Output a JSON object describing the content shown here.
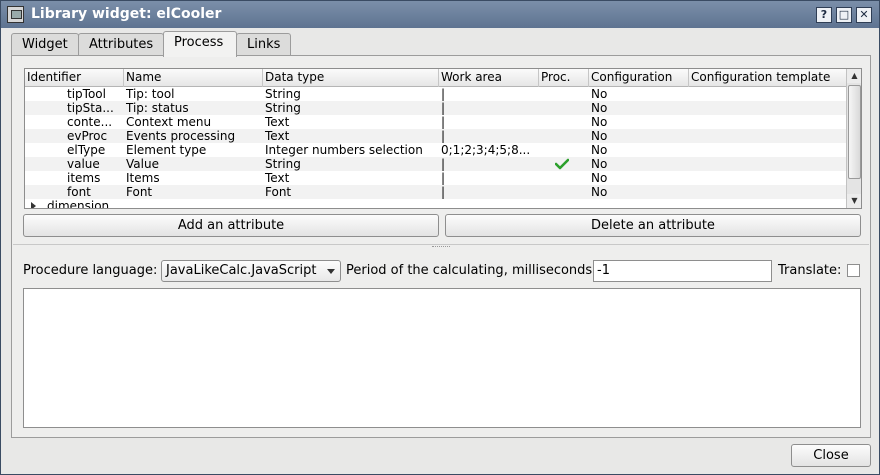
{
  "window": {
    "title": "Library widget: elCooler",
    "help_label": "?",
    "maximize_label": "□",
    "close_label": "✕"
  },
  "tabs": [
    {
      "label": "Widget"
    },
    {
      "label": "Attributes"
    },
    {
      "label": "Process"
    },
    {
      "label": "Links"
    }
  ],
  "table": {
    "columns": [
      "Identifier",
      "Name",
      "Data type",
      "Work area",
      "Proc.",
      "Configuration",
      "Configuration template"
    ],
    "rows": [
      {
        "id": "tipTool",
        "name": "Tip: tool",
        "type": "String",
        "work": "|",
        "proc": false,
        "config": "No",
        "template": ""
      },
      {
        "id": "tipSta...",
        "name": "Tip: status",
        "type": "String",
        "work": "|",
        "proc": false,
        "config": "No",
        "template": ""
      },
      {
        "id": "conte...",
        "name": "Context menu",
        "type": "Text",
        "work": "|",
        "proc": false,
        "config": "No",
        "template": ""
      },
      {
        "id": "evProc",
        "name": "Events processing",
        "type": "Text",
        "work": "|",
        "proc": false,
        "config": "No",
        "template": ""
      },
      {
        "id": "elType",
        "name": "Element type",
        "type": "Integer numbers selection",
        "work": "0;1;2;3;4;5;8...",
        "proc": false,
        "config": "No",
        "template": ""
      },
      {
        "id": "value",
        "name": "Value",
        "type": "String",
        "work": "|",
        "proc": true,
        "config": "No",
        "template": ""
      },
      {
        "id": "items",
        "name": "Items",
        "type": "Text",
        "work": "|",
        "proc": false,
        "config": "No",
        "template": ""
      },
      {
        "id": "font",
        "name": "Font",
        "type": "Font",
        "work": "|",
        "proc": false,
        "config": "No",
        "template": ""
      }
    ],
    "group_row": "dimension"
  },
  "buttons": {
    "add_attribute": "Add an attribute",
    "delete_attribute": "Delete an attribute",
    "close": "Close"
  },
  "procedure": {
    "language_label": "Procedure language:",
    "language_value": "JavaLikeCalc.JavaScript",
    "period_label": "Period of the calculating, milliseconds:",
    "period_value": "-1",
    "translate_label": "Translate:",
    "translate_checked": false,
    "code": ""
  },
  "colors": {
    "titlebar": "#6b7f9c",
    "check": "#2ca02c"
  }
}
